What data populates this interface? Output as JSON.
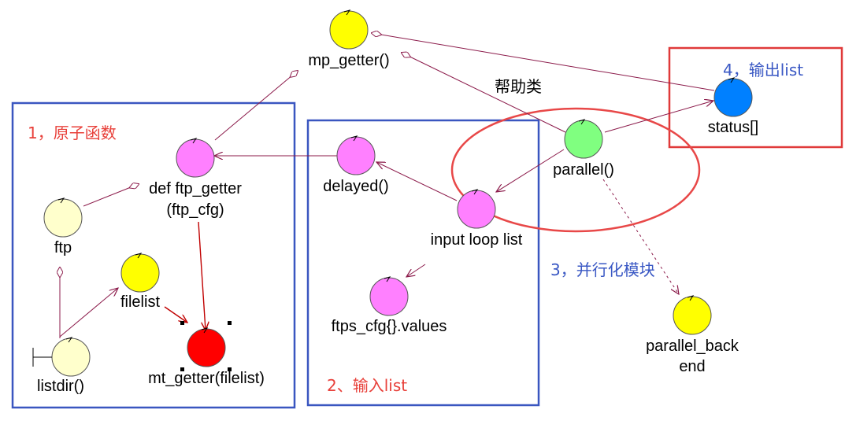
{
  "colors": {
    "box_blue": "#3a56c0",
    "box_red": "#e03a3a",
    "ellipse_red": "#e84848",
    "edge": "#8b1a4a",
    "yellow": "#ffff00",
    "cream": "#ffffcc",
    "magenta": "#ff80ff",
    "green": "#80ff80",
    "blue": "#0080ff",
    "red": "#ff0000"
  },
  "captions": {
    "atomic": "1，原子函数",
    "input": "2、输入list",
    "parallel": "3，并行化模块",
    "output": "4，输出list"
  },
  "annotation": "帮助类",
  "nodes": {
    "mp_getter": {
      "label": "mp_getter()",
      "icon": "control-node-icon"
    },
    "ftp_getter": {
      "line1": "def ftp_getter",
      "line2": "(ftp_cfg)",
      "icon": "control-node-icon"
    },
    "ftp": {
      "label": "ftp",
      "icon": "control-node-icon"
    },
    "filelist": {
      "label": "filelist",
      "icon": "control-node-icon"
    },
    "listdir": {
      "label": "listdir()",
      "icon": "boundary-node-icon"
    },
    "mt_getter": {
      "label": "mt_getter(filelist)",
      "icon": "control-node-icon"
    },
    "delayed": {
      "label": "delayed()",
      "icon": "control-node-icon"
    },
    "input_loop": {
      "label": "input loop list",
      "icon": "control-node-icon"
    },
    "ftps_cfg": {
      "label": "ftps_cfg{}.values",
      "icon": "control-node-icon"
    },
    "parallel": {
      "label": "parallel()",
      "icon": "control-node-icon"
    },
    "status": {
      "label": "status[]",
      "icon": "control-node-icon"
    },
    "parallel_backend": {
      "line1": "parallel_back",
      "line2": "end",
      "icon": "control-node-icon"
    }
  }
}
